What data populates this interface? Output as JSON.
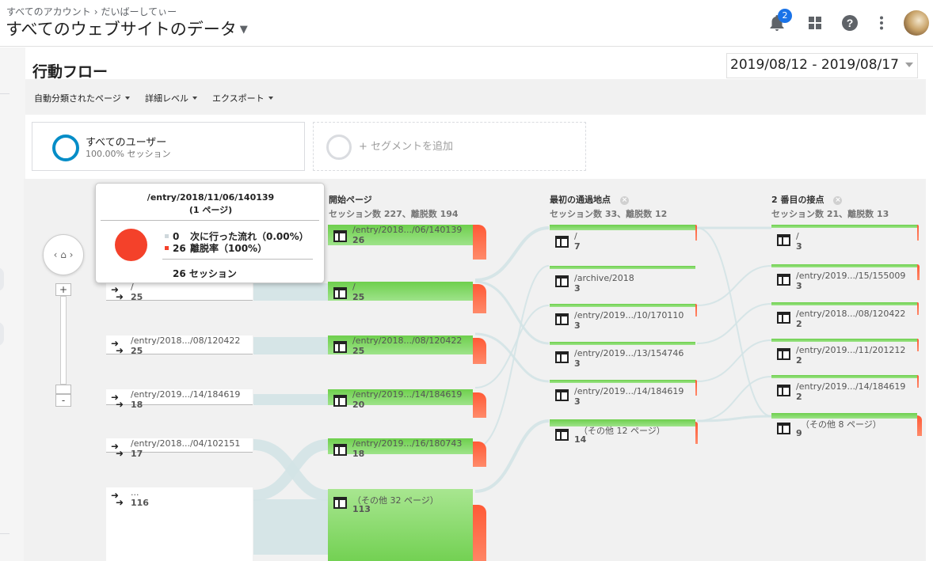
{
  "header": {
    "breadcrumb_account": "すべてのアカウント",
    "breadcrumb_sep": "›",
    "breadcrumb_property": "だいばーしてぃー",
    "view_title": "すべてのウェブサイトのデータ",
    "notification_count": "2",
    "icons": [
      "bell-icon",
      "apps-grid-icon",
      "help-icon",
      "more-vert-icon"
    ]
  },
  "report": {
    "title": "行動フロー",
    "date_range": "2019/08/12 - 2019/08/17",
    "toolbar": [
      "自動分類されたページ",
      "詳細レベル",
      "エクスポート"
    ]
  },
  "segments": {
    "all_users": "すべてのユーザー",
    "all_users_sub": "100.00% セッション",
    "add_segment": "+ セグメントを追加"
  },
  "colors": {
    "green": "#6ecf4d",
    "drop": "#ff5a36",
    "accent": "#058dc7",
    "link": "#cfe3e6"
  },
  "columns": [
    {
      "title": "開始ページ",
      "sub": "セッション数 227、離脱数 194"
    },
    {
      "title": "最初の通過地点",
      "sub": "セッション数 33、離脱数 12",
      "close": "×"
    },
    {
      "title": "2 番目の接点",
      "sub": "セッション数 21、離脱数 13",
      "close": "×"
    }
  ],
  "sources": [
    {
      "label": "/",
      "count": "25"
    },
    {
      "label": "/entry/2018.../08/120422",
      "count": "25"
    },
    {
      "label": "/entry/2019.../14/184619",
      "count": "18"
    },
    {
      "label": "/entry/2018.../04/102151",
      "count": "17"
    },
    {
      "label": "...",
      "count": "116"
    }
  ],
  "start_pages": [
    {
      "label": "/entry/2018.../06/140139",
      "count": "26"
    },
    {
      "label": "/",
      "count": "25"
    },
    {
      "label": "/entry/2018.../08/120422",
      "count": "25"
    },
    {
      "label": "/entry/2019.../14/184619",
      "count": "20"
    },
    {
      "label": "/entry/2019.../16/180743",
      "count": "18"
    },
    {
      "label": "（その他 32 ページ）",
      "count": "113"
    }
  ],
  "first_interaction": [
    {
      "label": "/",
      "count": "7"
    },
    {
      "label": "/archive/2018",
      "count": "3"
    },
    {
      "label": "/entry/2019.../10/170110",
      "count": "3"
    },
    {
      "label": "/entry/2019.../13/154746",
      "count": "3"
    },
    {
      "label": "/entry/2019.../14/184619",
      "count": "3"
    },
    {
      "label": "（その他 12 ページ）",
      "count": "14"
    }
  ],
  "second_interaction": [
    {
      "label": "/",
      "count": "3"
    },
    {
      "label": "/entry/2019.../15/155009",
      "count": "3"
    },
    {
      "label": "/entry/2018.../08/120422",
      "count": "2"
    },
    {
      "label": "/entry/2019.../11/201212",
      "count": "2"
    },
    {
      "label": "/entry/2019.../14/184619",
      "count": "2"
    },
    {
      "label": "（その他 8 ページ）",
      "count": "9"
    }
  ],
  "tooltip": {
    "title": "/entry/2018/11/06/140139",
    "subtitle": "(1 ページ)",
    "next_count": "0",
    "next_label": "次に行った流れ（0.00%）",
    "drop_count": "26",
    "drop_label": "離脱率（100%）",
    "sessions": "26 セッション"
  },
  "zoom": {
    "plus": "+",
    "minus": "-",
    "home": "‹ ⌂ ›"
  }
}
